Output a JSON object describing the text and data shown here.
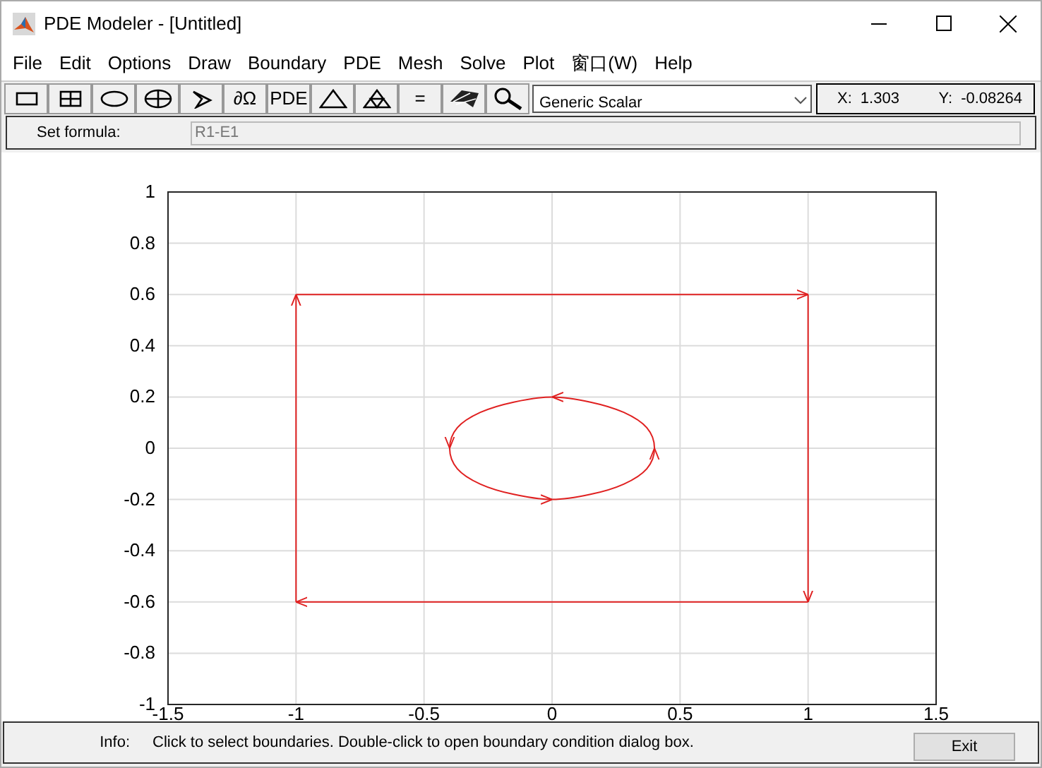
{
  "window": {
    "title": "PDE Modeler - [Untitled]"
  },
  "menu": [
    "File",
    "Edit",
    "Options",
    "Draw",
    "Boundary",
    "PDE",
    "Mesh",
    "Solve",
    "Plot",
    "窗口(W)",
    "Help"
  ],
  "toolbar": [
    {
      "kind": "icon"
    },
    {
      "kind": "icon"
    },
    {
      "kind": "icon"
    },
    {
      "kind": "icon"
    },
    {
      "kind": "icon"
    },
    {
      "kind": "text",
      "label": "∂Ω"
    },
    {
      "kind": "text",
      "label": "PDE"
    },
    {
      "kind": "icon"
    },
    {
      "kind": "icon"
    },
    {
      "kind": "text",
      "label": "="
    },
    {
      "kind": "icon"
    },
    {
      "kind": "icon"
    }
  ],
  "application_mode": {
    "value": "Generic Scalar"
  },
  "coordinates": {
    "x_label": "X:",
    "x_value": "1.303",
    "y_label": "Y:",
    "y_value": "-0.08264"
  },
  "formula": {
    "label": "Set formula:",
    "value": "R1-E1"
  },
  "chart_data": {
    "type": "line",
    "grid": true,
    "xlim": [
      -1.5,
      1.5
    ],
    "ylim": [
      -1,
      1
    ],
    "xticks": [
      -1.5,
      -1,
      -0.5,
      0,
      0.5,
      1,
      1.5
    ],
    "yticks": [
      -1,
      -0.8,
      -0.6,
      -0.4,
      -0.2,
      0,
      0.2,
      0.4,
      0.6,
      0.8,
      1
    ],
    "series": [
      {
        "color": "#e02020",
        "x": [
          -1,
          -1,
          1,
          1,
          -1
        ],
        "values": [
          -0.6,
          0.6,
          0.6,
          -0.6,
          -0.6
        ]
      },
      {
        "color": "#e02020",
        "x": [
          0.4,
          0.37,
          0.28,
          0.15,
          0,
          -0.15,
          -0.28,
          -0.37,
          -0.4,
          -0.37,
          -0.28,
          -0.15,
          0,
          0.15,
          0.28,
          0.37,
          0.4
        ],
        "values": [
          0,
          0.08,
          0.14,
          0.18,
          0.2,
          0.18,
          0.14,
          0.08,
          0,
          -0.08,
          -0.14,
          -0.18,
          -0.2,
          -0.18,
          -0.14,
          -0.08,
          0
        ]
      }
    ]
  },
  "info": {
    "label": "Info:",
    "text": "Click to select boundaries. Double-click to open boundary condition dialog box."
  },
  "buttons": [
    {
      "label": "Exit"
    }
  ]
}
